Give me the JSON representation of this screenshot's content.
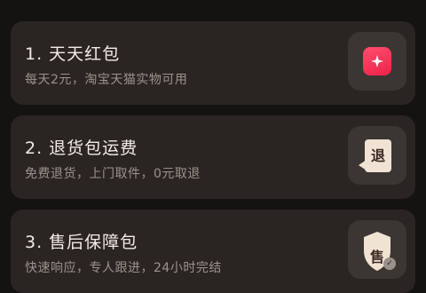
{
  "benefits": [
    {
      "title": "1. 天天红包",
      "subtitle": "每天2元，淘宝天猫实物可用",
      "icon": "red-packet-icon"
    },
    {
      "title": "2. 退货包运费",
      "subtitle": "免费退货，上门取件，0元取退",
      "icon": "return-icon",
      "icon_char": "退"
    },
    {
      "title": "3. 售后保障包",
      "subtitle": "快速响应，专人跟进，24小时完结",
      "icon": "shield-icon",
      "icon_char": "售"
    }
  ],
  "colors": {
    "background": "#151212",
    "card": "#2a2523",
    "accent": "#ff4d6d"
  }
}
